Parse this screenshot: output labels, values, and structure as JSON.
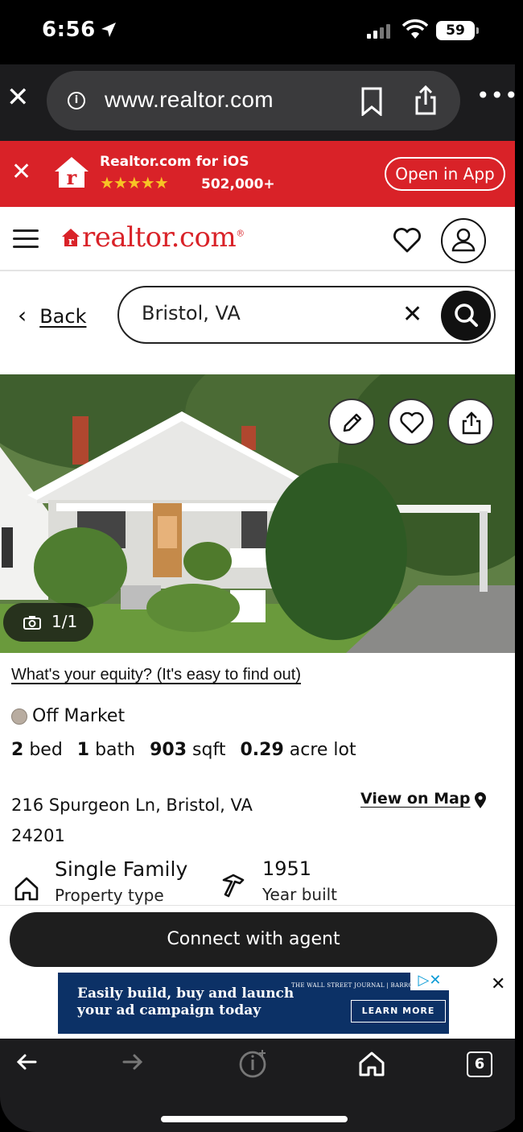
{
  "status_bar": {
    "time": "6:56",
    "battery": "59"
  },
  "browser": {
    "url": "www.realtor.com",
    "tabs_count": "6"
  },
  "app_banner": {
    "title": "Realtor.com for iOS",
    "rating_count": "502,000+",
    "open_label": "Open in App",
    "star_color": "#f7c325"
  },
  "header": {
    "brand": "realtor.com",
    "brand_color": "#d92228"
  },
  "search": {
    "back_label": "Back",
    "query": "Bristol, VA"
  },
  "photo": {
    "counter": "1/1"
  },
  "listing": {
    "equity_link": "What's your equity? (It's easy to find out)",
    "status": "Off Market",
    "beds": "2",
    "beds_label": "bed",
    "baths": "1",
    "baths_label": "bath",
    "sqft": "903",
    "sqft_label": "sqft",
    "lot": "0.29",
    "lot_label": "acre lot",
    "address_line1": "216 Spurgeon Ln, Bristol, VA",
    "address_line2": "24201",
    "map_link": "View on Map",
    "property_type": "Single Family",
    "property_type_label": "Property type",
    "year_built": "1951",
    "year_built_label": "Year built"
  },
  "cta": {
    "connect_label": "Connect with agent"
  },
  "ad": {
    "headline_line1": "Easily build, buy and launch",
    "headline_line2": "your ad campaign today",
    "brands": "THE WALL STREET JOURNAL | BARRON'S",
    "button": "LEARN MORE"
  }
}
